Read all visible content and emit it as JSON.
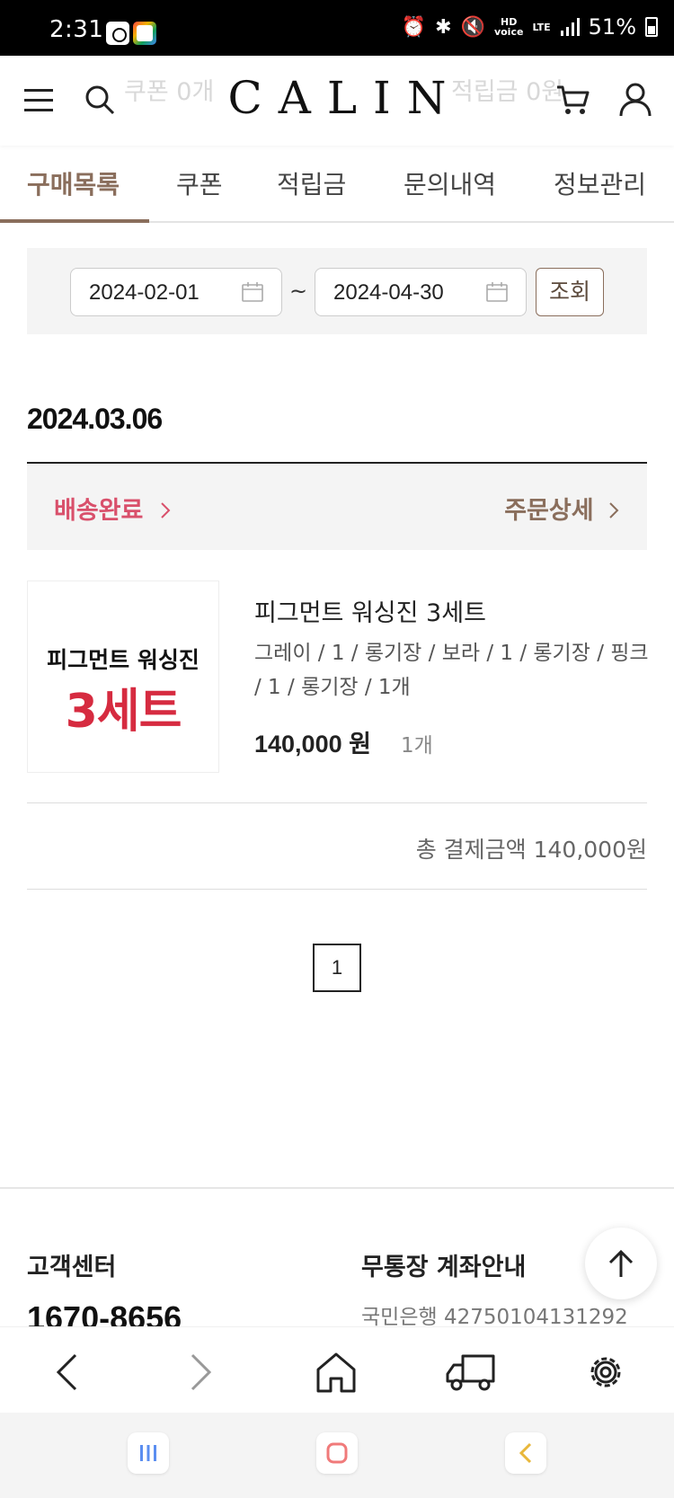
{
  "status_bar": {
    "time": "2:31",
    "network": "LTE",
    "battery": "51%"
  },
  "header": {
    "logo": "CALIN",
    "ghost_left": "쿠폰 0개",
    "ghost_right": "적립금 0원"
  },
  "tabs": [
    {
      "label": "구매목록",
      "active": true
    },
    {
      "label": "쿠폰",
      "active": false
    },
    {
      "label": "적립금",
      "active": false
    },
    {
      "label": "문의내역",
      "active": false
    },
    {
      "label": "정보관리",
      "active": false
    }
  ],
  "filter": {
    "start_date": "2024-02-01",
    "end_date": "2024-04-30",
    "separator": "~",
    "search_label": "조회"
  },
  "order": {
    "date": "2024.03.06",
    "status": "배송완료",
    "detail_label": "주문상세",
    "thumb_line1": "피그먼트 워싱진",
    "thumb_line2": "3세트",
    "product_name": "피그먼트 워싱진 3세트",
    "options": "그레이 / 1 / 롱기장 / 보라 / 1 / 롱기장 / 핑크  / 1 / 롱기장 / 1개",
    "price": "140,000 원",
    "quantity": "1개",
    "total": "총 결제금액 140,000원"
  },
  "pagination": {
    "current": "1"
  },
  "footer": {
    "cs_title": "고객센터",
    "cs_phone": "1670-8656",
    "bank_title": "무통장 계좌안내",
    "bank_info": "국민은행 42750104131292"
  },
  "colors": {
    "accent": "#8a6e5c",
    "status": "#d9506b",
    "thumb_red": "#d62b40"
  }
}
